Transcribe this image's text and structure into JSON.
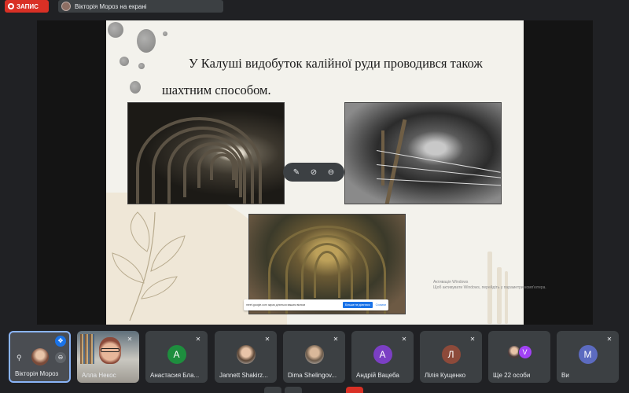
{
  "topbar": {
    "recording_label": "ЗАПИС",
    "presenter_label": "Вікторія Мороз на екрані"
  },
  "slide": {
    "title_line1": "У Калуші видобуток калійної руди проводився також",
    "title_line2": "шахтним способом."
  },
  "share_bar": {
    "text": "meet.google.com зараз ділиться вашим вікном",
    "stop_label": "Більше не ділитися",
    "hide_label": "Сховати"
  },
  "watermark": {
    "line1": "Активація Windows",
    "line2": "Щоб активувати Windows, перейдіть у параметри комп'ютера."
  },
  "participants": [
    {
      "name": "Вікторія Мороз",
      "kind": "self"
    },
    {
      "name": "Алла Некос",
      "kind": "camera"
    },
    {
      "name": "Анастасия Бла...",
      "kind": "letter",
      "initial": "А",
      "color": "#1e8e3e"
    },
    {
      "name": "Jannett Shakirz...",
      "kind": "photo"
    },
    {
      "name": "Dima Shelingov...",
      "kind": "photo"
    },
    {
      "name": "Андрій Вацеба",
      "kind": "letter",
      "initial": "А",
      "color": "#7b3fc4"
    },
    {
      "name": "Лілія Кущенко",
      "kind": "letter",
      "initial": "Л",
      "color": "#8d4a3a"
    },
    {
      "name": "Ще 22 особи",
      "kind": "more",
      "initial": "V"
    },
    {
      "name": "Ви",
      "kind": "letter",
      "initial": "М",
      "color": "#5c6bc0"
    }
  ],
  "icons": {
    "mic_off": "✕",
    "pin": "⚲",
    "expand": "✥"
  },
  "colors": {
    "recording": "#d93025",
    "accent": "#1a73e8",
    "self_border": "#8ab4f8"
  }
}
